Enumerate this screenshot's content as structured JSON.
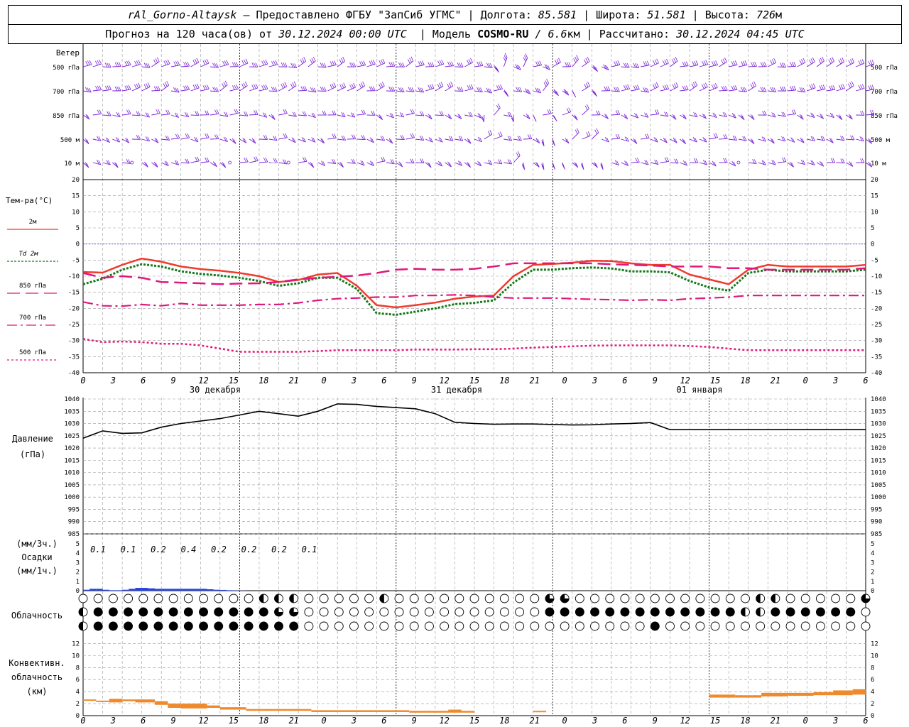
{
  "header": {
    "station": "rAl_Gorno-Altaysk",
    "dash": " — ",
    "provider": "Предоставлено ФГБУ \"ЗапСиб УГМС\"",
    "lon_label": "Долгота:",
    "lon": "85.581",
    "lat_label": "Широта:",
    "lat": "51.581",
    "alt_label": "Высота:",
    "alt": "726",
    "alt_unit": "м",
    "sep": " | "
  },
  "subheader": {
    "forecast": "Прогноз на 120 часа(ов) от",
    "start": "30.12.2024 00:00 UTC",
    "model_label": "| Модель",
    "model": "COSMO-RU",
    "model_res": "/ 6.6",
    "model_res_unit": "км",
    "calc_label": "| Рассчитано:",
    "calc": "30.12.2024 04:45 UTC"
  },
  "colors": {
    "t2m": "#ef3b2c",
    "td2m": "#14791a",
    "t850": "#e0187c",
    "t700": "#e0187c",
    "t500": "#e0187c",
    "wind": "#7a1fd8",
    "pressure": "#000000",
    "precip": "#2843d8",
    "conv": "#ef8a2c",
    "zero": "#3a3ad8",
    "grid": "#999999"
  },
  "wind_panel": {
    "title": "Ветер",
    "levels": [
      "500 гПа",
      "700 гПа",
      "850 гПа",
      "500 м",
      "10 м"
    ]
  },
  "time_axis": {
    "ticks": [
      "0",
      "3",
      "6",
      "9",
      "12",
      "15",
      "18",
      "21",
      "0",
      "3",
      "6",
      "9",
      "12",
      "15",
      "18",
      "21",
      "0",
      "3",
      "6",
      "9",
      "12",
      "15",
      "18",
      "21",
      "0",
      "3",
      "6"
    ],
    "days": [
      "30 декабря",
      "31 декабря",
      "01 января"
    ]
  },
  "precip_panel": {
    "label_lines": [
      "(мм/3ч.)",
      "Осадки",
      "(мм/1ч.)"
    ],
    "ticks": [
      "0",
      "1",
      "2",
      "3",
      "4",
      "5"
    ],
    "amounts_3h": [
      "0.1",
      "0.1",
      "0.2",
      "0.4",
      "0.2",
      "0.2",
      "0.2",
      "0.1"
    ]
  },
  "cloud_panel": {
    "label": "Облачность"
  },
  "conv_panel": {
    "label_lines": [
      "Конвективн.",
      "облачность",
      "(км)"
    ],
    "ticks": [
      "0",
      "2",
      "4",
      "6",
      "8",
      "10",
      "12"
    ]
  },
  "chart_data": [
    {
      "type": "line",
      "title": "Тем-ра(°C)",
      "xlabel": "",
      "ylabel": "Тем-ра(°C)",
      "x_hours": [
        0,
        3,
        6,
        9,
        12,
        15,
        18,
        21,
        24,
        27,
        30,
        33,
        36,
        39,
        42,
        45,
        48,
        51,
        54,
        57,
        60,
        63,
        66,
        69,
        72,
        75,
        78,
        81,
        84,
        87,
        90,
        93,
        96,
        99,
        102,
        105,
        108,
        111,
        114,
        117,
        120
      ],
      "ylim": [
        -40,
        20
      ],
      "yticks": [
        "20",
        "15",
        "10",
        "5",
        "0",
        "-5",
        "-10",
        "-15",
        "-20",
        "-25",
        "-30",
        "-35",
        "-40"
      ],
      "series": [
        {
          "name": "2м",
          "values": [
            -8.7,
            -8.9,
            -6.5,
            -4.5,
            -5.5,
            -7.0,
            -7.8,
            -8.3,
            -9.0,
            -10.0,
            -11.8,
            -11.2,
            -9.5,
            -9.0,
            -13.0,
            -19.0,
            -19.7,
            -19.0,
            -18.2,
            -17.0,
            -16.3,
            -16.0,
            -10.0,
            -6.5,
            -6.2,
            -5.8,
            -5.2,
            -5.3,
            -6.0,
            -6.5,
            -6.5,
            -9.5,
            -11.0,
            -12.5,
            -8.0,
            -6.5,
            -7.0,
            -7.0,
            -7.0,
            -7.0,
            -6.5
          ]
        },
        {
          "name": "Td 2м",
          "values": [
            -12.5,
            -10.8,
            -8.0,
            -6.3,
            -7.0,
            -8.5,
            -9.3,
            -9.8,
            -10.5,
            -11.5,
            -13.0,
            -12.2,
            -10.5,
            -10.5,
            -14.0,
            -21.5,
            -22.0,
            -21.0,
            -20.0,
            -18.7,
            -18.3,
            -17.5,
            -12.0,
            -8.0,
            -8.0,
            -7.5,
            -7.3,
            -7.6,
            -8.5,
            -8.5,
            -8.8,
            -11.5,
            -13.5,
            -14.5,
            -9.0,
            -8.0,
            -8.5,
            -8.5,
            -8.5,
            -8.5,
            -8.0
          ]
        },
        {
          "name": "850 гПа",
          "values": [
            -9.0,
            -10.5,
            -10.0,
            -10.5,
            -11.8,
            -12.0,
            -12.2,
            -12.5,
            -12.3,
            -12.2,
            -11.8,
            -11.0,
            -10.5,
            -10.2,
            -9.8,
            -9.0,
            -8.0,
            -7.7,
            -8.0,
            -8.0,
            -7.7,
            -7.0,
            -6.0,
            -6.0,
            -6.0,
            -6.0,
            -6.0,
            -6.3,
            -6.5,
            -6.7,
            -7.0,
            -7.0,
            -7.0,
            -7.5,
            -7.5,
            -8.0,
            -8.0,
            -8.0,
            -8.0,
            -8.0,
            -7.5
          ]
        },
        {
          "name": "700 гПа",
          "values": [
            -18.0,
            -19.2,
            -19.3,
            -18.8,
            -19.2,
            -18.5,
            -19.0,
            -19.0,
            -19.0,
            -18.8,
            -18.8,
            -18.3,
            -17.5,
            -17.0,
            -16.8,
            -16.5,
            -16.5,
            -16.0,
            -16.0,
            -15.8,
            -16.0,
            -16.5,
            -16.8,
            -16.8,
            -16.8,
            -17.0,
            -17.2,
            -17.3,
            -17.5,
            -17.3,
            -17.5,
            -17.0,
            -16.8,
            -16.5,
            -16.0,
            -16.0,
            -16.0,
            -16.0,
            -16.0,
            -16.0,
            -16.0
          ]
        },
        {
          "name": "500 гПа",
          "values": [
            -29.5,
            -30.5,
            -30.3,
            -30.5,
            -31.0,
            -31.0,
            -31.5,
            -32.5,
            -33.5,
            -33.5,
            -33.5,
            -33.5,
            -33.3,
            -33.0,
            -33.0,
            -33.0,
            -33.0,
            -32.8,
            -32.8,
            -32.8,
            -32.7,
            -32.7,
            -32.5,
            -32.2,
            -32.0,
            -31.8,
            -31.6,
            -31.5,
            -31.5,
            -31.5,
            -31.5,
            -31.7,
            -32.0,
            -32.5,
            -33.0,
            -33.0,
            -33.0,
            -33.0,
            -33.0,
            -33.0,
            -33.0
          ]
        }
      ]
    },
    {
      "type": "line",
      "title": "Давление",
      "ylabel": "(гПа)",
      "x_hours": [
        0,
        3,
        6,
        9,
        12,
        15,
        18,
        21,
        24,
        27,
        30,
        33,
        36,
        39,
        42,
        45,
        48,
        51,
        54,
        57,
        60,
        63,
        66,
        69,
        72,
        75,
        78,
        81,
        84,
        87,
        90,
        93,
        96,
        99,
        102,
        105,
        108,
        111,
        114,
        117,
        120
      ],
      "ylim": [
        985,
        1040
      ],
      "yticks": [
        "1040",
        "1035",
        "1030",
        "1025",
        "1020",
        "1015",
        "1010",
        "1005",
        "1000",
        "995",
        "990",
        "985"
      ],
      "series": [
        {
          "name": "Давление",
          "values": [
            1024.0,
            1027.0,
            1026.0,
            1026.2,
            1028.5,
            1030.0,
            1031.0,
            1032.0,
            1033.5,
            1035.0,
            1034.0,
            1033.0,
            1035.0,
            1038.0,
            1037.8,
            1037.0,
            1036.5,
            1036.0,
            1034.0,
            1030.5,
            1030.0,
            1029.7,
            1029.8,
            1029.8,
            1029.6,
            1029.4,
            1029.5,
            1029.8,
            1030.0,
            1030.4,
            1027.5,
            1027.5,
            1027.5,
            1027.5,
            1027.5,
            1027.5,
            1027.5,
            1027.5,
            1027.5,
            1027.5,
            1027.5
          ]
        }
      ]
    },
    {
      "type": "bar",
      "title": "Осадки",
      "ylabel": "мм/1ч.",
      "ylim": [
        0,
        5
      ],
      "x_hours": [
        1,
        2,
        3,
        4,
        5,
        6,
        7,
        8,
        9,
        10,
        11,
        12,
        13,
        14,
        15,
        16,
        17,
        18,
        19,
        20,
        21,
        22,
        23,
        24,
        25
      ],
      "values": [
        0.1,
        0.2,
        0.2,
        0.1,
        0.05,
        0.05,
        0.1,
        0.2,
        0.3,
        0.3,
        0.25,
        0.2,
        0.2,
        0.2,
        0.2,
        0.2,
        0.2,
        0.2,
        0.2,
        0.15,
        0.1,
        0.08,
        0.05,
        0.02,
        0.02
      ]
    },
    {
      "type": "bar",
      "title": "Конвективн. облачность",
      "ylabel": "(км)",
      "ylim": [
        0,
        13
      ],
      "segments": [
        {
          "from": 0,
          "to": 2,
          "bottom": 2.5,
          "top": 2.7
        },
        {
          "from": 2,
          "to": 4,
          "bottom": 2.3,
          "top": 2.5
        },
        {
          "from": 4,
          "to": 6,
          "bottom": 2.2,
          "top": 2.8
        },
        {
          "from": 6,
          "to": 8,
          "bottom": 2.4,
          "top": 2.7
        },
        {
          "from": 8,
          "to": 11,
          "bottom": 2.2,
          "top": 2.7
        },
        {
          "from": 11,
          "to": 13,
          "bottom": 1.8,
          "top": 2.4
        },
        {
          "from": 13,
          "to": 15,
          "bottom": 1.3,
          "top": 2.0
        },
        {
          "from": 15,
          "to": 19,
          "bottom": 1.2,
          "top": 2.0
        },
        {
          "from": 19,
          "to": 21,
          "bottom": 1.3,
          "top": 1.7
        },
        {
          "from": 21,
          "to": 25,
          "bottom": 1.0,
          "top": 1.4
        },
        {
          "from": 25,
          "to": 35,
          "bottom": 0.8,
          "top": 1.1
        },
        {
          "from": 35,
          "to": 50,
          "bottom": 0.6,
          "top": 0.9
        },
        {
          "from": 50,
          "to": 60,
          "bottom": 0.5,
          "top": 0.8
        },
        {
          "from": 56,
          "to": 58,
          "bottom": 0.8,
          "top": 1.0
        },
        {
          "from": 69,
          "to": 71,
          "bottom": 0.6,
          "top": 0.8
        },
        {
          "from": 96,
          "to": 100,
          "bottom": 3.0,
          "top": 3.5
        },
        {
          "from": 100,
          "to": 104,
          "bottom": 3.0,
          "top": 3.4
        },
        {
          "from": 104,
          "to": 108,
          "bottom": 3.2,
          "top": 3.8
        },
        {
          "from": 108,
          "to": 112,
          "bottom": 3.3,
          "top": 3.8
        },
        {
          "from": 112,
          "to": 115,
          "bottom": 3.4,
          "top": 3.9
        },
        {
          "from": 115,
          "to": 118,
          "bottom": 3.4,
          "top": 4.2
        },
        {
          "from": 118,
          "to": 120,
          "bottom": 3.5,
          "top": 4.4
        }
      ]
    }
  ]
}
